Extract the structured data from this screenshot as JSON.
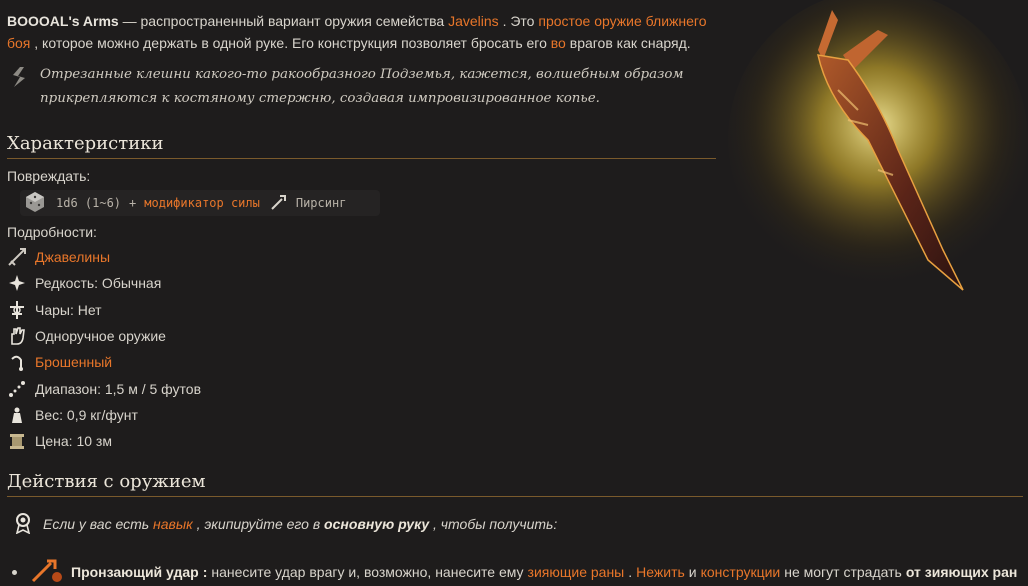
{
  "intro": {
    "name": "BOOOAL's Arms",
    "dash": "—",
    "t1": "распространенный вариант оружия семейства",
    "family": "Javelins",
    "t2": ". Это",
    "simple_link": "простое оружие ближнего боя",
    "t3": ", которое можно держать в одной руке. Его конструкция позволяет бросать его",
    "in_link": "во",
    "t4": "врагов как снаряд."
  },
  "quote": "Отрезанные клешни какого-то ракообразного Подземья, кажется, волшебным образом прикрепляются к костяному стержню, создавая импровизированное копье.",
  "characteristics": {
    "title": "Характеристики",
    "damage_label": "Повреждать:",
    "damage_dice": "1d6 (1~6)",
    "plus": "+",
    "modifier": "модификатор силы",
    "damage_type": "Пирсинг",
    "details_label": "Подробности:"
  },
  "properties": [
    {
      "icon": "javelin-icon",
      "text": "Джавелины",
      "link": true
    },
    {
      "icon": "sparkle-icon",
      "text": "Редкость: Обычная",
      "link": false
    },
    {
      "icon": "enchant-icon",
      "text": "Чары: Нет",
      "link": false
    },
    {
      "icon": "hand-icon",
      "text": "Одноручное оружие",
      "link": false
    },
    {
      "icon": "thrown-icon",
      "text": "Брошенный",
      "link": true
    },
    {
      "icon": "range-icon",
      "text": "Диапазон: 1,5 м / 5 футов",
      "link": false
    },
    {
      "icon": "weight-icon",
      "text": "Вес: 0,9 кг/фунт",
      "link": false
    },
    {
      "icon": "price-icon",
      "text": "Цена: 10 зм",
      "link": false
    }
  ],
  "actions": {
    "title": "Действия с оружием",
    "cond1": "Если у вас есть",
    "skill_link": "навык",
    "cond2": ", экипируйте его в",
    "main_hand": "основную руку",
    "cond3": ", чтобы получить:",
    "item_name": "Пронзающий удар",
    "colon": ":",
    "i1": "нанесите удар врагу и, возможно, нанесите ему",
    "wounds_link": "зияющие раны",
    "i2": ".",
    "undead_link": "Нежить",
    "i3": "и",
    "constructs_link": "конструкции",
    "i4": "не могут страдать",
    "i5": "от зияющих ран"
  },
  "colors": {
    "accent": "#e8762a",
    "text": "#d8d4cc",
    "background": "#1e1c1c"
  }
}
